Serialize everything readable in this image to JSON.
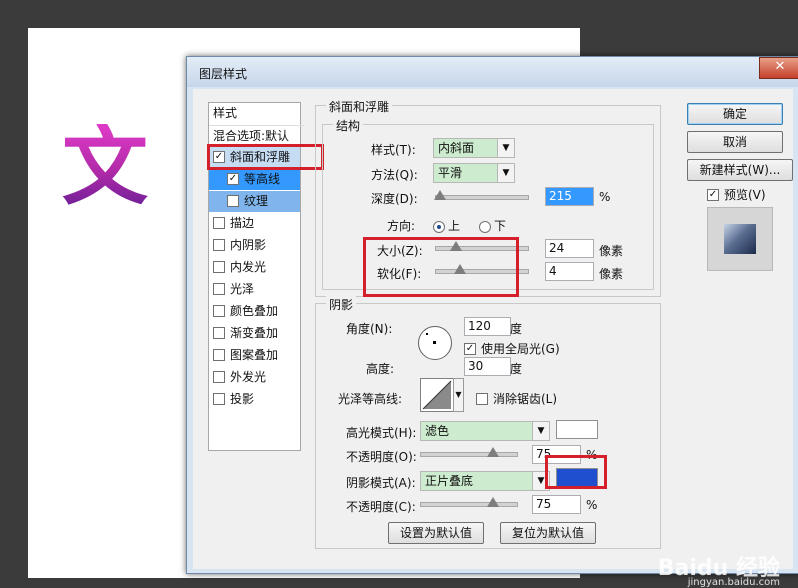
{
  "dialog": {
    "title": "图层样式",
    "close_label": "✕"
  },
  "canvas": {
    "glyph": "文"
  },
  "style_list": {
    "header": "样式",
    "blend": "混合选项:默认",
    "items": [
      {
        "label": "斜面和浮雕",
        "checked": true
      },
      {
        "label": "等高线",
        "checked": true
      },
      {
        "label": "纹理",
        "checked": false
      },
      {
        "label": "描边",
        "checked": false
      },
      {
        "label": "内阴影",
        "checked": false
      },
      {
        "label": "内发光",
        "checked": false
      },
      {
        "label": "光泽",
        "checked": false
      },
      {
        "label": "颜色叠加",
        "checked": false
      },
      {
        "label": "渐变叠加",
        "checked": false
      },
      {
        "label": "图案叠加",
        "checked": false
      },
      {
        "label": "外发光",
        "checked": false
      },
      {
        "label": "投影",
        "checked": false
      }
    ]
  },
  "bevel": {
    "group_title": "斜面和浮雕",
    "structure_title": "结构",
    "style_label": "样式(T):",
    "style_value": "内斜面",
    "method_label": "方法(Q):",
    "method_value": "平滑",
    "depth_label": "深度(D):",
    "depth_value": "215",
    "depth_unit": "%",
    "direction_label": "方向:",
    "dir_up": "上",
    "dir_down": "下",
    "size_label": "大小(Z):",
    "size_value": "24",
    "size_unit": "像素",
    "soften_label": "软化(F):",
    "soften_value": "4",
    "soften_unit": "像素"
  },
  "shading": {
    "group_title": "阴影",
    "angle_label": "角度(N):",
    "angle_value": "120",
    "angle_unit": "度",
    "global_light": "使用全局光(G)",
    "altitude_label": "高度:",
    "altitude_value": "30",
    "altitude_unit": "度",
    "gloss_label": "光泽等高线:",
    "antialias": "消除锯齿(L)",
    "highlight_mode_label": "高光模式(H):",
    "highlight_mode_value": "滤色",
    "highlight_color": "#ffffff",
    "highlight_opacity_label": "不透明度(O):",
    "highlight_opacity_value": "75",
    "shadow_mode_label": "阴影模式(A):",
    "shadow_mode_value": "正片叠底",
    "shadow_color": "#1f4fcf",
    "shadow_opacity_label": "不透明度(C):",
    "shadow_opacity_value": "75",
    "percent": "%"
  },
  "footer": {
    "set_default": "设置为默认值",
    "reset_default": "复位为默认值"
  },
  "right_panel": {
    "ok": "确定",
    "cancel": "取消",
    "new_style": "新建样式(W)...",
    "preview": "预览(V)"
  },
  "watermark": {
    "logo": "Baidu 经验",
    "url": "jingyan.baidu.com"
  }
}
